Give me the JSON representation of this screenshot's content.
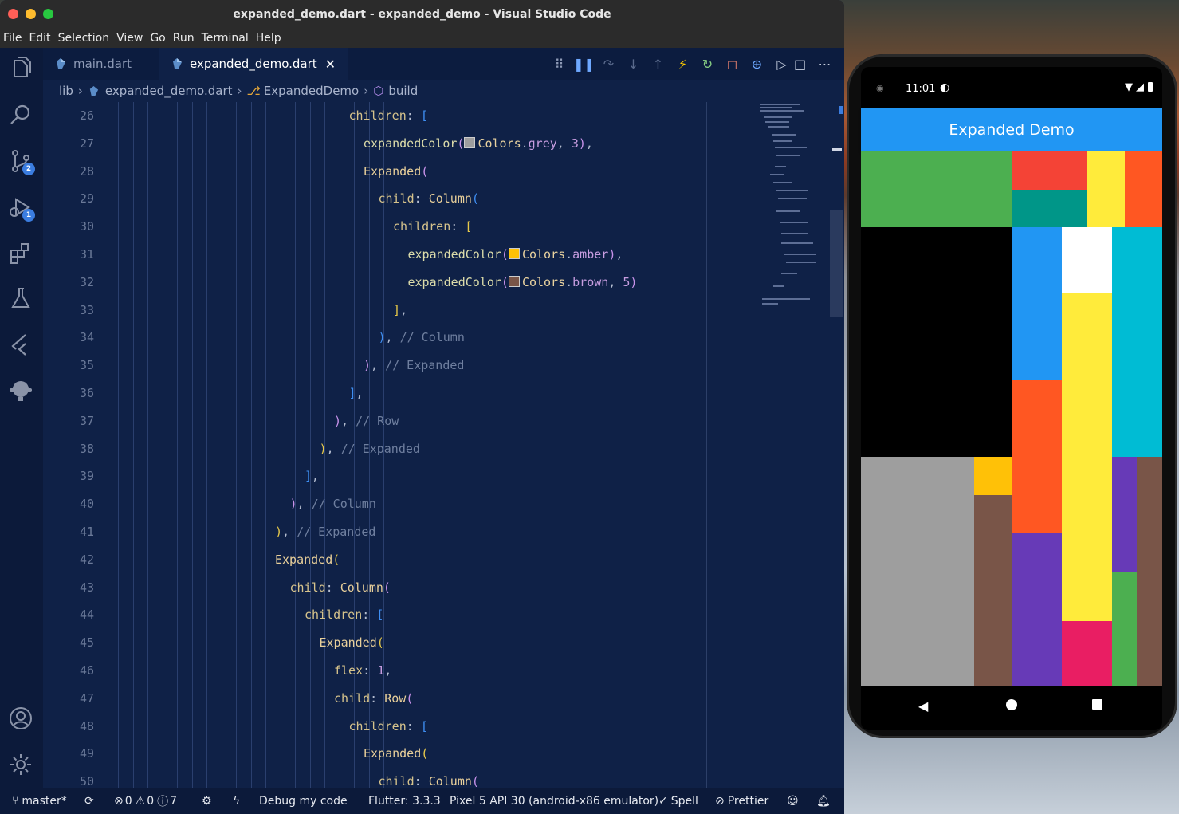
{
  "window": {
    "title": "expanded_demo.dart - expanded_demo - Visual Studio Code",
    "menu": [
      "File",
      "Edit",
      "Selection",
      "View",
      "Go",
      "Run",
      "Terminal",
      "Help"
    ]
  },
  "activity_bar": {
    "source_control_badge": "2",
    "debug_badge": "1"
  },
  "tabs": [
    {
      "label": "main.dart",
      "active": false
    },
    {
      "label": "expanded_demo.dart",
      "active": true
    }
  ],
  "breadcrumb": [
    "lib",
    "expanded_demo.dart",
    "ExpandedDemo",
    "build"
  ],
  "editor": {
    "line_numbers": [
      "26",
      "27",
      "28",
      "29",
      "30",
      "31",
      "32",
      "33",
      "34",
      "35",
      "36",
      "37",
      "38",
      "39",
      "40",
      "41",
      "42",
      "43",
      "44",
      "45",
      "46",
      "47",
      "48",
      "49",
      "50"
    ],
    "lines": [
      {
        "indent": 16,
        "tokens": [
          [
            "prop",
            "children"
          ],
          [
            "p",
            ": "
          ],
          [
            "b3",
            "["
          ]
        ]
      },
      {
        "indent": 17,
        "tokens": [
          [
            "w",
            "expandedColor"
          ],
          [
            "b2",
            "("
          ],
          [
            "sw",
            "#9e9e9e"
          ],
          [
            "id",
            "Colors"
          ],
          [
            "p",
            "."
          ],
          [
            "num",
            "grey"
          ],
          [
            "p",
            ", "
          ],
          [
            "num",
            "3"
          ],
          [
            "b2",
            ")"
          ],
          [
            "p",
            ","
          ]
        ]
      },
      {
        "indent": 17,
        "tokens": [
          [
            "ty",
            "Expanded"
          ],
          [
            "b2",
            "("
          ]
        ]
      },
      {
        "indent": 18,
        "tokens": [
          [
            "prop",
            "child"
          ],
          [
            "p",
            ": "
          ],
          [
            "ty",
            "Column"
          ],
          [
            "b3",
            "("
          ]
        ]
      },
      {
        "indent": 19,
        "tokens": [
          [
            "prop",
            "children"
          ],
          [
            "p",
            ": "
          ],
          [
            "b1",
            "["
          ]
        ]
      },
      {
        "indent": 20,
        "tokens": [
          [
            "w",
            "expandedColor"
          ],
          [
            "b2",
            "("
          ],
          [
            "sw",
            "#ffc107"
          ],
          [
            "id",
            "Colors"
          ],
          [
            "p",
            "."
          ],
          [
            "num",
            "amber"
          ],
          [
            "b2",
            ")"
          ],
          [
            "p",
            ","
          ]
        ]
      },
      {
        "indent": 20,
        "tokens": [
          [
            "w",
            "expandedColor"
          ],
          [
            "b2",
            "("
          ],
          [
            "sw",
            "#795548"
          ],
          [
            "id",
            "Colors"
          ],
          [
            "p",
            "."
          ],
          [
            "num",
            "brown"
          ],
          [
            "p",
            ", "
          ],
          [
            "num",
            "5"
          ],
          [
            "b2",
            ")"
          ]
        ]
      },
      {
        "indent": 19,
        "tokens": [
          [
            "b1",
            "]"
          ],
          [
            "p",
            ","
          ]
        ]
      },
      {
        "indent": 18,
        "tokens": [
          [
            "b3",
            ")"
          ],
          [
            "p",
            ", "
          ],
          [
            "cm",
            "// Column"
          ]
        ]
      },
      {
        "indent": 17,
        "tokens": [
          [
            "b2",
            ")"
          ],
          [
            "p",
            ", "
          ],
          [
            "cm",
            "// Expanded"
          ]
        ]
      },
      {
        "indent": 16,
        "tokens": [
          [
            "b3",
            "]"
          ],
          [
            "p",
            ","
          ]
        ]
      },
      {
        "indent": 15,
        "tokens": [
          [
            "b2",
            ")"
          ],
          [
            "p",
            ", "
          ],
          [
            "cm",
            "// Row"
          ]
        ]
      },
      {
        "indent": 14,
        "tokens": [
          [
            "b1",
            ")"
          ],
          [
            "p",
            ", "
          ],
          [
            "cm",
            "// Expanded"
          ]
        ]
      },
      {
        "indent": 13,
        "tokens": [
          [
            "b3",
            "]"
          ],
          [
            "p",
            ","
          ]
        ]
      },
      {
        "indent": 12,
        "tokens": [
          [
            "b2",
            ")"
          ],
          [
            "p",
            ", "
          ],
          [
            "cm",
            "// Column"
          ]
        ]
      },
      {
        "indent": 11,
        "tokens": [
          [
            "b1",
            ")"
          ],
          [
            "p",
            ", "
          ],
          [
            "cm",
            "// Expanded"
          ]
        ]
      },
      {
        "indent": 11,
        "tokens": [
          [
            "ty",
            "Expanded"
          ],
          [
            "b1",
            "("
          ]
        ]
      },
      {
        "indent": 12,
        "tokens": [
          [
            "prop",
            "child"
          ],
          [
            "p",
            ": "
          ],
          [
            "ty",
            "Column"
          ],
          [
            "b2",
            "("
          ]
        ]
      },
      {
        "indent": 13,
        "tokens": [
          [
            "prop",
            "children"
          ],
          [
            "p",
            ": "
          ],
          [
            "b3",
            "["
          ]
        ]
      },
      {
        "indent": 14,
        "tokens": [
          [
            "ty",
            "Expanded"
          ],
          [
            "b1",
            "("
          ]
        ]
      },
      {
        "indent": 15,
        "tokens": [
          [
            "prop",
            "flex"
          ],
          [
            "p",
            ": "
          ],
          [
            "num",
            "1"
          ],
          [
            "p",
            ","
          ]
        ]
      },
      {
        "indent": 15,
        "tokens": [
          [
            "prop",
            "child"
          ],
          [
            "p",
            ": "
          ],
          [
            "ty",
            "Row"
          ],
          [
            "b2",
            "("
          ]
        ]
      },
      {
        "indent": 16,
        "tokens": [
          [
            "prop",
            "children"
          ],
          [
            "p",
            ": "
          ],
          [
            "b3",
            "["
          ]
        ]
      },
      {
        "indent": 17,
        "tokens": [
          [
            "ty",
            "Expanded"
          ],
          [
            "b1",
            "("
          ]
        ]
      },
      {
        "indent": 18,
        "tokens": [
          [
            "prop",
            "child"
          ],
          [
            "p",
            ": "
          ],
          [
            "ty",
            "Column"
          ],
          [
            "b2",
            "("
          ]
        ]
      }
    ]
  },
  "status_bar": {
    "branch": "master*",
    "errors": "0",
    "warnings": "0",
    "infos": "7",
    "launch": "Debug my code",
    "flutter": "Flutter: 3.3.3",
    "device": "Pixel 5 API 30 (android-x86 emulator)",
    "spell": "Spell",
    "prettier": "Prettier"
  },
  "phone": {
    "time": "11:01",
    "app_title": "Expanded Demo",
    "colors": {
      "green": "#4caf50",
      "red": "#f44336",
      "teal": "#009688",
      "yellow": "#ffeb3b",
      "deepOrange": "#ff5722",
      "black": "#000000",
      "blue": "#2196f3",
      "white": "#ffffff",
      "cyan": "#00bcd4",
      "grey": "#9e9e9e",
      "amber": "#ffc107",
      "brown": "#795548",
      "deepPurple": "#673ab7",
      "pink": "#e91e63"
    }
  }
}
